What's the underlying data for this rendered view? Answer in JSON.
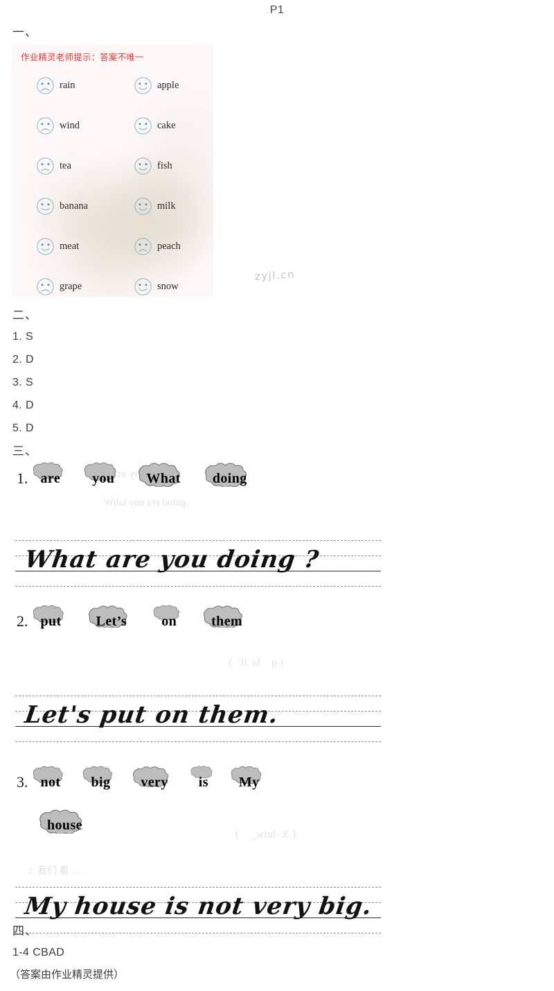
{
  "header": {
    "page_label": "P1"
  },
  "watermark": {
    "text": "zyjl.cn"
  },
  "sections": {
    "one": {
      "number": "一、",
      "hint": "作业精灵老师提示：答案不唯一",
      "faces": [
        {
          "left": {
            "word": "rain",
            "face": "sad-face-icon"
          },
          "right": {
            "word": "apple",
            "face": "happy-face-icon"
          }
        },
        {
          "left": {
            "word": "wind",
            "face": "sad-face-icon"
          },
          "right": {
            "word": "cake",
            "face": "happy-face-icon"
          }
        },
        {
          "left": {
            "word": "tea",
            "face": "sad-face-icon"
          },
          "right": {
            "word": "fish",
            "face": "happy-face-icon"
          }
        },
        {
          "left": {
            "word": "banana",
            "face": "happy-face-icon"
          },
          "right": {
            "word": "milk",
            "face": "happy-face-icon"
          }
        },
        {
          "left": {
            "word": "meat",
            "face": "happy-face-icon"
          },
          "right": {
            "word": "peach",
            "face": "sad-face-icon"
          }
        },
        {
          "left": {
            "word": "grape",
            "face": "sad-face-icon"
          },
          "right": {
            "word": "snow",
            "face": "happy-face-icon"
          }
        }
      ]
    },
    "two": {
      "number": "二、",
      "answers": [
        "1. S",
        "2. D",
        "3. S",
        "4. D",
        "5. D"
      ]
    },
    "three": {
      "number": "三、",
      "questions": [
        {
          "index": "1.",
          "clouds": [
            "are",
            "you",
            "What",
            "doing"
          ],
          "answer": "What are you doing ?"
        },
        {
          "index": "2.",
          "clouds": [
            "put",
            "Let’s",
            "on",
            "them"
          ],
          "answer": "Let's put on them."
        },
        {
          "index": "3.",
          "clouds": [
            "not",
            "big",
            "very",
            "is",
            "My"
          ],
          "clouds_row2": [
            "house"
          ],
          "answer": "My house is not very big."
        }
      ]
    },
    "four": {
      "number": "四、",
      "answer": "1-4 CBAD",
      "source_note": "（答案由作业精灵提供）"
    }
  },
  "colors": {
    "hint_red": "#e8373c",
    "face_outline": "#86b8cf",
    "face_eye": "#3a9ec9",
    "text_dark": "#3a3a3a",
    "watermark_gray": "#b9bcc2",
    "cloud_fill": "#b9b9b9"
  }
}
